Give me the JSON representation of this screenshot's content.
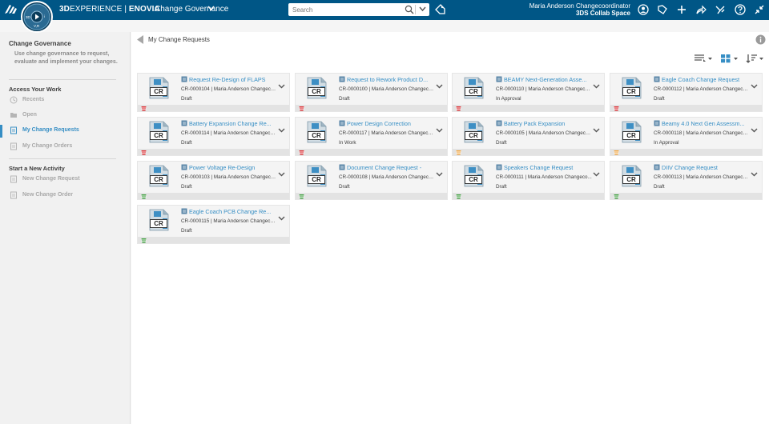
{
  "header": {
    "brand_bold": "3D",
    "brand_mid": "EXPERIENCE | ",
    "brand_app": "ENOVIA",
    "app_title": "Change Governance",
    "compass_labels": [
      "3D",
      "V,R",
      "i"
    ],
    "search_placeholder": "Search",
    "user_name": "Maria Anderson Changecoordinator",
    "collab_space": "3DS Collab Space",
    "bar_color": "#005686"
  },
  "sidebar": {
    "title": "Change Governance",
    "description": "Use change governance to request, evaluate and implement your changes.",
    "access_title": "Access Your Work",
    "access_items": [
      {
        "label": "Recents",
        "icon": "clock-icon"
      },
      {
        "label": "Open",
        "icon": "folder-open-icon"
      },
      {
        "label": "My Change Requests",
        "icon": "change-request-icon",
        "active": true
      },
      {
        "label": "My Change Orders",
        "icon": "change-order-icon"
      }
    ],
    "start_title": "Start a New Activity",
    "start_items": [
      {
        "label": "New Change Request",
        "icon": "new-request-icon"
      },
      {
        "label": "New Change Order",
        "icon": "new-order-icon"
      }
    ]
  },
  "main": {
    "breadcrumb": "My Change Requests",
    "thumbnail_label": "CR",
    "cards": [
      {
        "title": "Request Re-Design of FLAPS",
        "meta": "CR-0000104 | Maria Anderson Changeco...",
        "state": "Draft",
        "priority": "high"
      },
      {
        "title": "Request to Rework Product D...",
        "meta": "CR-0000100 | Maria Anderson Changeco...",
        "state": "Draft",
        "priority": "high"
      },
      {
        "title": "BEAMY Next-Generation Asse...",
        "meta": "CR-0000110 | Maria Anderson Changeco...",
        "state": "In Approval",
        "priority": "high"
      },
      {
        "title": "Eagle Coach Change Request",
        "meta": "CR-0000112 | Maria Anderson Changeco...",
        "state": "Draft",
        "priority": "high"
      },
      {
        "title": "Battery Expansion Change Re...",
        "meta": "CR-0000114 | Maria Anderson Changeco...",
        "state": "Draft",
        "priority": "high"
      },
      {
        "title": "Power Design Correction",
        "meta": "CR-0000117 | Maria Anderson Changeco...",
        "state": "In Work",
        "priority": "high"
      },
      {
        "title": "Battery Pack Expansion",
        "meta": "CR-0000105 | Maria Anderson Changeco...",
        "state": "Draft",
        "priority": "medium"
      },
      {
        "title": "Beamy 4.0 Next Gen Assessm...",
        "meta": "CR-0000118 | Maria Anderson Changeco...",
        "state": "In Approval",
        "priority": "medium"
      },
      {
        "title": "Power Voltage Re-Design",
        "meta": "CR-0000103 | Maria Anderson Changeco...",
        "state": "Draft",
        "priority": "low"
      },
      {
        "title": "Document Change Request -",
        "meta": "CR-0000108 | Maria Anderson Changeco...",
        "state": "Draft",
        "priority": "low"
      },
      {
        "title": "Speakers Change Request",
        "meta": "CR-0000111 | Maria Anderson Changeco...",
        "state": "Draft",
        "priority": "low"
      },
      {
        "title": "DIIV Change Request",
        "meta": "CR-0000113 | Maria Anderson Changeco...",
        "state": "Draft",
        "priority": "low"
      },
      {
        "title": "Eagle Coach PCB Change Re...",
        "meta": "CR-0000115 | Maria Anderson Changeco...",
        "state": "Draft",
        "priority": "low"
      }
    ]
  },
  "colors": {
    "priority_high": "#d9262b",
    "priority_medium": "#f0a238",
    "priority_low": "#3a9b3a",
    "link": "#368ec4"
  }
}
